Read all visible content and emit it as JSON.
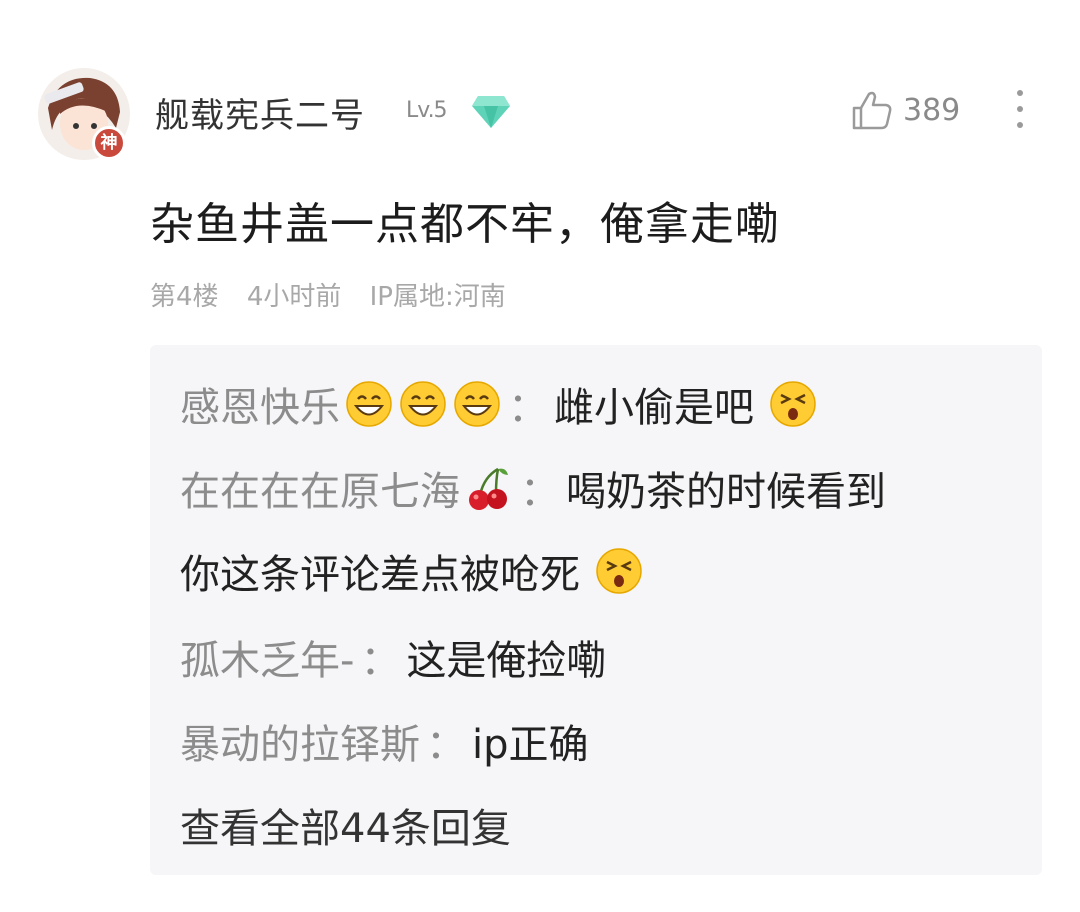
{
  "comment": {
    "username": "舰载宪兵二号",
    "level": "Lv.5",
    "avatar_badge": "神",
    "likes": "389",
    "text": "杂鱼井盖一点都不牢，俺拿走嘞",
    "meta": {
      "floor": "第4楼",
      "time": "4小时前",
      "ip": "IP属地:河南"
    }
  },
  "replies": [
    {
      "user": "感恩快乐",
      "user_emojis": [
        "grin-emoji",
        "grin-emoji",
        "grin-emoji"
      ],
      "colon": "：",
      "text": "雌小偷是吧",
      "text_emoji": "squint-emoji"
    },
    {
      "user": "在在在在原七海",
      "user_emojis": [
        "cherry-emoji"
      ],
      "colon": "：",
      "text": "喝奶茶的时候看到",
      "continuation": "你这条评论差点被呛死",
      "text_emoji": "squint-emoji"
    },
    {
      "user": "孤木乏年-",
      "colon": "：",
      "text": "这是俺捡嘞"
    },
    {
      "user": "暴动的拉铎斯",
      "colon": "：",
      "text": "ip正确"
    }
  ],
  "see_all": "查看全部44条回复",
  "colors": {
    "reply_bg": "#f6f6f8",
    "username_gray": "#8c8c8c",
    "gem": "#5fd3b8"
  }
}
